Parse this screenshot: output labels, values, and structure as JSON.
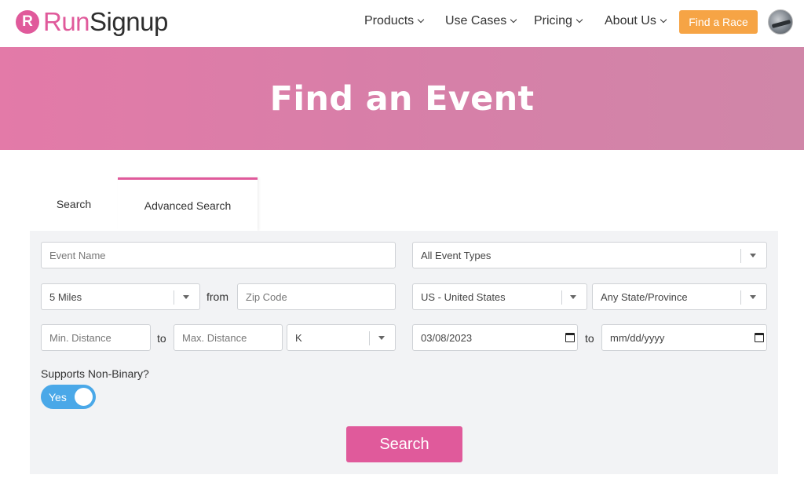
{
  "brand": {
    "badge": "R",
    "run": "Run",
    "signup": "Signup",
    "accent": "#e05a9b"
  },
  "nav": {
    "items": [
      {
        "label": "Products"
      },
      {
        "label": "Use Cases"
      },
      {
        "label": "Pricing"
      },
      {
        "label": "About Us"
      }
    ],
    "find_race": "Find a Race",
    "find_race_color": "#f6a445"
  },
  "banner": {
    "title": "Find an Event"
  },
  "tabs": {
    "search": "Search",
    "advanced": "Advanced Search"
  },
  "form": {
    "event_name_placeholder": "Event Name",
    "event_type": "All Event Types",
    "radius": "5 Miles",
    "from_label": "from",
    "zip_placeholder": "Zip Code",
    "country": "US - United States",
    "state": "Any State/Province",
    "min_distance_placeholder": "Min. Distance",
    "to_label": "to",
    "max_distance_placeholder": "Max. Distance",
    "distance_unit": "K",
    "start_date": "03/08/2023",
    "date_to_label": "to",
    "end_date_placeholder": "mm/dd/yyyy",
    "non_binary_label": "Supports Non-Binary?",
    "non_binary_toggle": "Yes",
    "toggle_color": "#4aa8e8",
    "search_button": "Search"
  }
}
